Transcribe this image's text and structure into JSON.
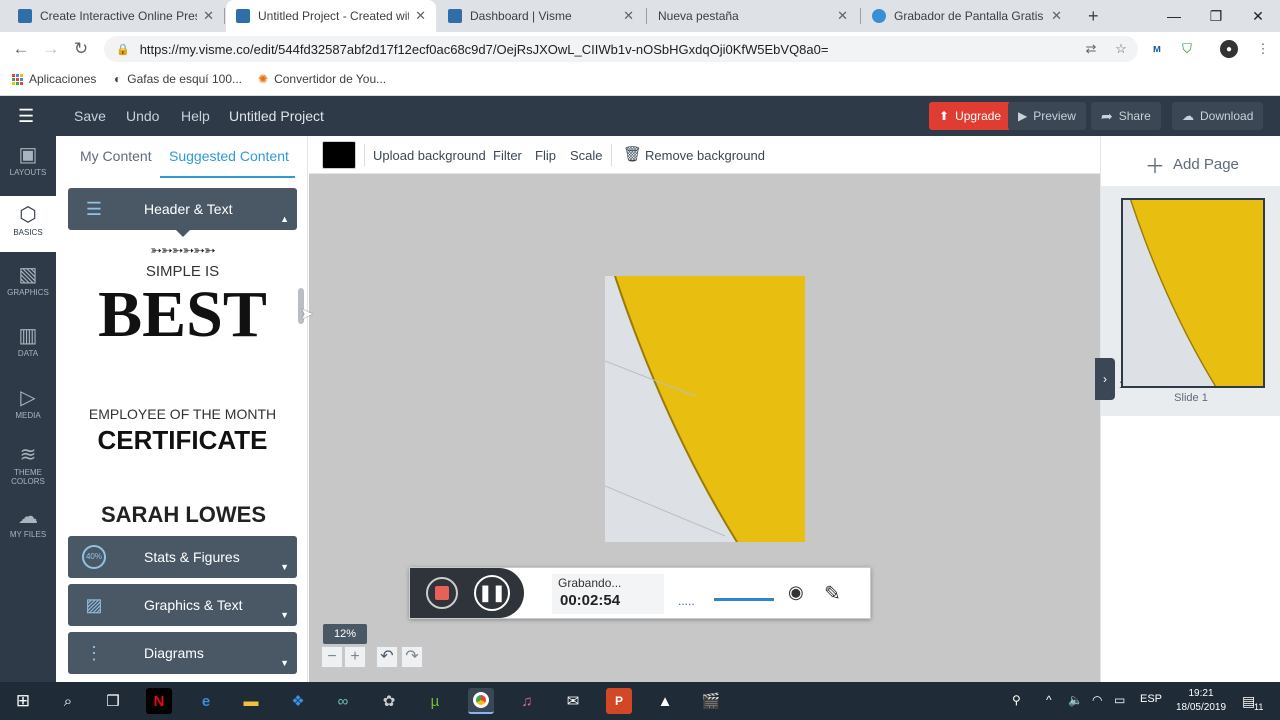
{
  "browser": {
    "tabs": [
      {
        "title": "Create Interactive Online Prese",
        "active": false
      },
      {
        "title": "Untitled Project - Created with",
        "active": true
      },
      {
        "title": "Dashboard | Visme",
        "active": false
      },
      {
        "title": "Nueva pestaña",
        "active": false
      },
      {
        "title": "Grabador de Pantalla Gratis – (",
        "active": false
      }
    ],
    "new_tab": "+",
    "url": "https://my.visme.co/edit/544fd32587abf2d17f12ecf0ac68c9d7/OejRsJXOwL_CIIWb1v-nOSbHGxdqOji0KfW5EbVQ8a0=",
    "bookmarks": [
      {
        "label": "Aplicaciones",
        "icon": "apps-grid-icon"
      },
      {
        "label": "Gafas de esquí 100...",
        "icon": "goggles-icon"
      },
      {
        "label": "Convertidor de You...",
        "icon": "audio-icon"
      }
    ]
  },
  "visme": {
    "menu": [
      "Save",
      "Undo",
      "Help"
    ],
    "project_title": "Untitled Project",
    "buttons": {
      "upgrade": "Upgrade",
      "preview": "Preview",
      "share": "Share",
      "download": "Download"
    },
    "rail": [
      {
        "label": "LAYOUTS"
      },
      {
        "label": "BASICS"
      },
      {
        "label": "GRAPHICS"
      },
      {
        "label": "DATA"
      },
      {
        "label": "MEDIA"
      },
      {
        "label": "THEME",
        "label2": "COLORS"
      },
      {
        "label": "MY FILES"
      }
    ],
    "panel": {
      "tabs": [
        "My Content",
        "Suggested Content"
      ],
      "header_text": "Header & Text",
      "sample": {
        "simple": "SIMPLE IS",
        "best": "BEST",
        "employee": "EMPLOYEE OF THE MONTH",
        "certificate": "CERTIFICATE",
        "name": "SARAH LOWES"
      },
      "sections": [
        "Stats & Figures",
        "Graphics & Text",
        "Diagrams"
      ],
      "stats_badge": "40%"
    },
    "toolbar": {
      "bg_color": "#000000",
      "items": [
        "Upload background",
        "Filter",
        "Flip",
        "Scale",
        "Remove background"
      ]
    },
    "zoom": "12%",
    "add_page": "Add Page",
    "slide_number": "1",
    "slide_label": "Slide 1"
  },
  "recorder": {
    "status": "Grabando...",
    "time": "00:02:54",
    "dots": "....."
  },
  "taskbar": {
    "lang": "ESP",
    "time": "19:21",
    "date": "18/05/2019",
    "notif_count": "11"
  },
  "colors": {
    "accent": "#2e9bd6",
    "dark": "#2e3a47",
    "upgrade": "#e03c31",
    "yellow": "#e8bf10"
  }
}
